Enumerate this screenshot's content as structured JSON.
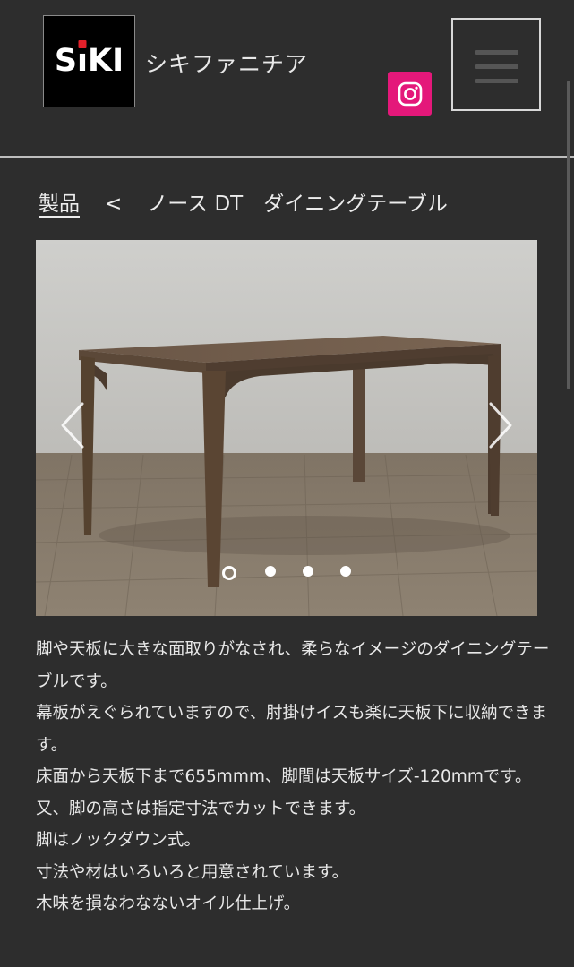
{
  "header": {
    "logo_text": "SiKI",
    "brand_name": "シキファニチア",
    "instagram_icon": "instagram-icon",
    "menu_icon": "hamburger-menu-icon"
  },
  "breadcrumb": {
    "parent": "製品",
    "separator": "<",
    "current": "ノース DT　ダイニングテーブル"
  },
  "carousel": {
    "prev_icon": "chevron-left-icon",
    "next_icon": "chevron-right-icon",
    "slide_count": 4,
    "active_slide": 1
  },
  "description": {
    "lines": [
      "脚や天板に大きな面取りがなされ、柔らなイメージのダイニングテーブルです。",
      "幕板がえぐられていますので、肘掛けイスも楽に天板下に収納できます。",
      "床面から天板下まで655mmm、脚間は天板サイズ-120mmです。",
      "又、脚の高さは指定寸法でカットできます。",
      "脚はノックダウン式。",
      "寸法や材はいろいろと用意されています。",
      "木味を損なわなないオイル仕上げ。"
    ]
  },
  "colors": {
    "background": "#2d2d2d",
    "instagram": "#e4187a",
    "logo_accent": "#e3202a"
  }
}
